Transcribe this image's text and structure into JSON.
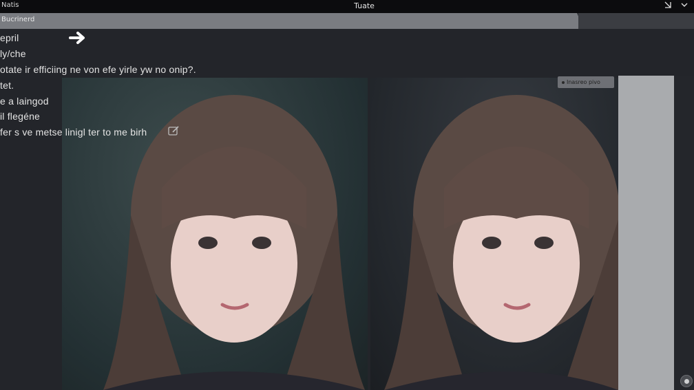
{
  "titlebar": {
    "app_name": "Natis",
    "title": "Tuate",
    "controls": [
      "minimize-icon",
      "chevron-down-icon"
    ]
  },
  "tabstrip": {
    "tab_label": "Bucrinerd"
  },
  "log": {
    "lines": [
      "epril",
      "ly/che",
      "otate ir efficiing ne von efe yirle yw no onip?.",
      "tet.",
      "e a laingod",
      "il flegéne",
      "fer s ve metse linigl ter to me birh"
    ]
  },
  "image_panel": {
    "badge_label": "Inasreo pivo"
  },
  "icons": {
    "arrow": "arrow-right-icon",
    "edit": "edit-icon",
    "fab": "record-icon"
  },
  "colors": {
    "background": "#23252a",
    "titlebar": "#0c0c0e",
    "tab_bar": "#7a7c81",
    "sidebar": "#a9abae"
  }
}
